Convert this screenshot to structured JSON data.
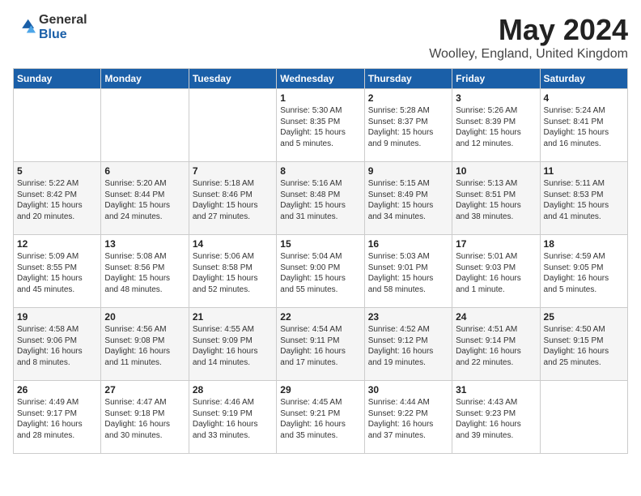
{
  "logo": {
    "general": "General",
    "blue": "Blue"
  },
  "title": "May 2024",
  "location": "Woolley, England, United Kingdom",
  "days_header": [
    "Sunday",
    "Monday",
    "Tuesday",
    "Wednesday",
    "Thursday",
    "Friday",
    "Saturday"
  ],
  "weeks": [
    [
      {
        "num": "",
        "info": ""
      },
      {
        "num": "",
        "info": ""
      },
      {
        "num": "",
        "info": ""
      },
      {
        "num": "1",
        "info": "Sunrise: 5:30 AM\nSunset: 8:35 PM\nDaylight: 15 hours\nand 5 minutes."
      },
      {
        "num": "2",
        "info": "Sunrise: 5:28 AM\nSunset: 8:37 PM\nDaylight: 15 hours\nand 9 minutes."
      },
      {
        "num": "3",
        "info": "Sunrise: 5:26 AM\nSunset: 8:39 PM\nDaylight: 15 hours\nand 12 minutes."
      },
      {
        "num": "4",
        "info": "Sunrise: 5:24 AM\nSunset: 8:41 PM\nDaylight: 15 hours\nand 16 minutes."
      }
    ],
    [
      {
        "num": "5",
        "info": "Sunrise: 5:22 AM\nSunset: 8:42 PM\nDaylight: 15 hours\nand 20 minutes."
      },
      {
        "num": "6",
        "info": "Sunrise: 5:20 AM\nSunset: 8:44 PM\nDaylight: 15 hours\nand 24 minutes."
      },
      {
        "num": "7",
        "info": "Sunrise: 5:18 AM\nSunset: 8:46 PM\nDaylight: 15 hours\nand 27 minutes."
      },
      {
        "num": "8",
        "info": "Sunrise: 5:16 AM\nSunset: 8:48 PM\nDaylight: 15 hours\nand 31 minutes."
      },
      {
        "num": "9",
        "info": "Sunrise: 5:15 AM\nSunset: 8:49 PM\nDaylight: 15 hours\nand 34 minutes."
      },
      {
        "num": "10",
        "info": "Sunrise: 5:13 AM\nSunset: 8:51 PM\nDaylight: 15 hours\nand 38 minutes."
      },
      {
        "num": "11",
        "info": "Sunrise: 5:11 AM\nSunset: 8:53 PM\nDaylight: 15 hours\nand 41 minutes."
      }
    ],
    [
      {
        "num": "12",
        "info": "Sunrise: 5:09 AM\nSunset: 8:55 PM\nDaylight: 15 hours\nand 45 minutes."
      },
      {
        "num": "13",
        "info": "Sunrise: 5:08 AM\nSunset: 8:56 PM\nDaylight: 15 hours\nand 48 minutes."
      },
      {
        "num": "14",
        "info": "Sunrise: 5:06 AM\nSunset: 8:58 PM\nDaylight: 15 hours\nand 52 minutes."
      },
      {
        "num": "15",
        "info": "Sunrise: 5:04 AM\nSunset: 9:00 PM\nDaylight: 15 hours\nand 55 minutes."
      },
      {
        "num": "16",
        "info": "Sunrise: 5:03 AM\nSunset: 9:01 PM\nDaylight: 15 hours\nand 58 minutes."
      },
      {
        "num": "17",
        "info": "Sunrise: 5:01 AM\nSunset: 9:03 PM\nDaylight: 16 hours\nand 1 minute."
      },
      {
        "num": "18",
        "info": "Sunrise: 4:59 AM\nSunset: 9:05 PM\nDaylight: 16 hours\nand 5 minutes."
      }
    ],
    [
      {
        "num": "19",
        "info": "Sunrise: 4:58 AM\nSunset: 9:06 PM\nDaylight: 16 hours\nand 8 minutes."
      },
      {
        "num": "20",
        "info": "Sunrise: 4:56 AM\nSunset: 9:08 PM\nDaylight: 16 hours\nand 11 minutes."
      },
      {
        "num": "21",
        "info": "Sunrise: 4:55 AM\nSunset: 9:09 PM\nDaylight: 16 hours\nand 14 minutes."
      },
      {
        "num": "22",
        "info": "Sunrise: 4:54 AM\nSunset: 9:11 PM\nDaylight: 16 hours\nand 17 minutes."
      },
      {
        "num": "23",
        "info": "Sunrise: 4:52 AM\nSunset: 9:12 PM\nDaylight: 16 hours\nand 19 minutes."
      },
      {
        "num": "24",
        "info": "Sunrise: 4:51 AM\nSunset: 9:14 PM\nDaylight: 16 hours\nand 22 minutes."
      },
      {
        "num": "25",
        "info": "Sunrise: 4:50 AM\nSunset: 9:15 PM\nDaylight: 16 hours\nand 25 minutes."
      }
    ],
    [
      {
        "num": "26",
        "info": "Sunrise: 4:49 AM\nSunset: 9:17 PM\nDaylight: 16 hours\nand 28 minutes."
      },
      {
        "num": "27",
        "info": "Sunrise: 4:47 AM\nSunset: 9:18 PM\nDaylight: 16 hours\nand 30 minutes."
      },
      {
        "num": "28",
        "info": "Sunrise: 4:46 AM\nSunset: 9:19 PM\nDaylight: 16 hours\nand 33 minutes."
      },
      {
        "num": "29",
        "info": "Sunrise: 4:45 AM\nSunset: 9:21 PM\nDaylight: 16 hours\nand 35 minutes."
      },
      {
        "num": "30",
        "info": "Sunrise: 4:44 AM\nSunset: 9:22 PM\nDaylight: 16 hours\nand 37 minutes."
      },
      {
        "num": "31",
        "info": "Sunrise: 4:43 AM\nSunset: 9:23 PM\nDaylight: 16 hours\nand 39 minutes."
      },
      {
        "num": "",
        "info": ""
      }
    ]
  ]
}
